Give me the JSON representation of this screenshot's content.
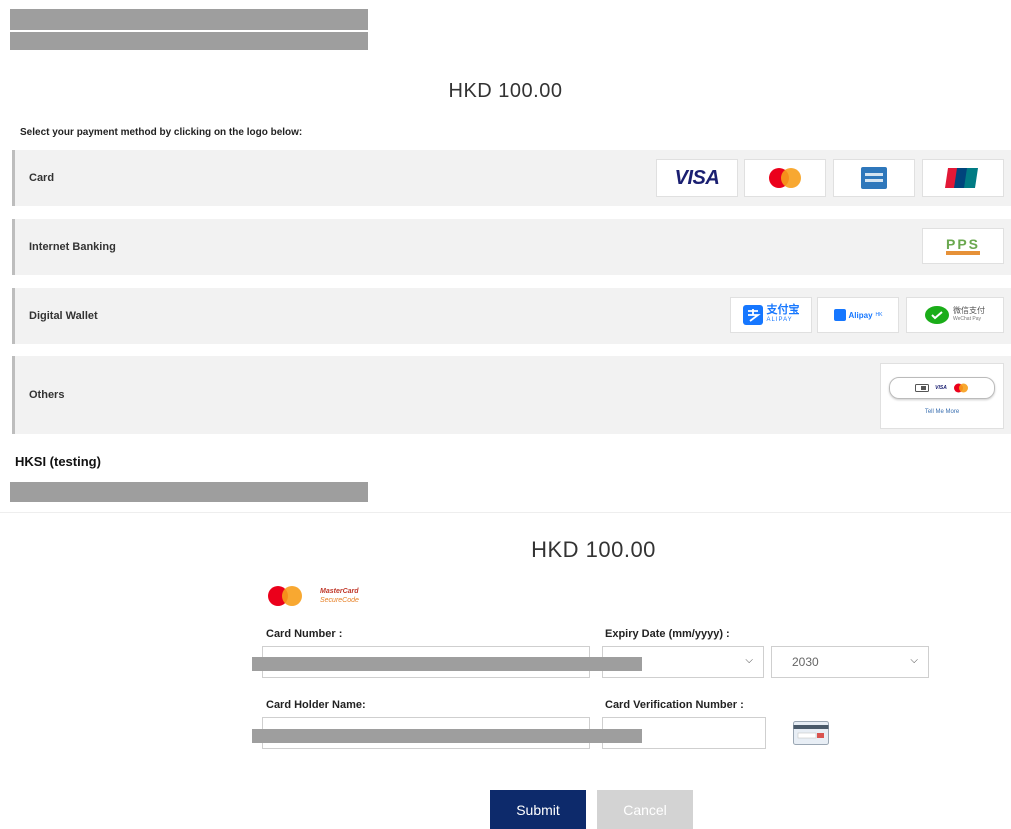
{
  "amount_top": "HKD 100.00",
  "instruction": "Select your payment method by clicking on the logo below:",
  "methods": [
    {
      "label": "Card"
    },
    {
      "label": "Internet Banking"
    },
    {
      "label": "Digital Wallet"
    },
    {
      "label": "Others"
    }
  ],
  "logos": {
    "visa": "VISA",
    "pps": "PPS",
    "alipay_cn": "支付宝",
    "alipay_cn_sub": "ALIPAY",
    "alipay_hk": "Alipay",
    "alipay_hk_sup": "HK",
    "wechat": "微信支付",
    "wechat_sub": "WeChat Pay",
    "others_visa": "VISA",
    "tell_me_more": "Tell Me More"
  },
  "merchant_name": "HKSI (testing)",
  "amount_bottom": "HKD 100.00",
  "securecode": {
    "line1": "MasterCard",
    "line2": "SecureCode"
  },
  "form": {
    "card_number_label": "Card Number :",
    "expiry_label": "Expiry Date (mm/yyyy) :",
    "expiry_year": "2030",
    "card_holder_label": "Card Holder Name:",
    "cvn_label": "Card Verification Number :"
  },
  "buttons": {
    "submit": "Submit",
    "cancel": "Cancel"
  },
  "colors": {
    "visa_blue": "#1a1f71",
    "mc_red": "#eb001b",
    "mc_orange": "#f79e1b",
    "submit_bg": "#0d2a6b",
    "cancel_bg": "#d3d3d3",
    "row_bg": "#f2f2f2"
  }
}
